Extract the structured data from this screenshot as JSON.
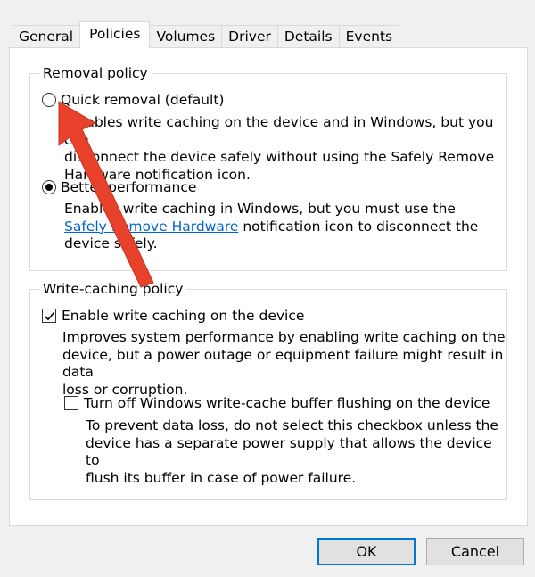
{
  "tabs": [
    {
      "label": "General"
    },
    {
      "label": "Policies"
    },
    {
      "label": "Volumes"
    },
    {
      "label": "Driver"
    },
    {
      "label": "Details"
    },
    {
      "label": "Events"
    }
  ],
  "removal": {
    "title": "Removal policy",
    "quick_label": "Quick removal (default)",
    "quick_desc_1": "Disables write caching on the device and in Windows, but you can",
    "quick_desc_2": "disconnect the device safely without using the Safely Remove",
    "quick_desc_3": "Hardware notification icon.",
    "better_label": "Better performance",
    "better_desc_1": "Enables write caching in Windows, but you must use the",
    "better_link": "Safely Remove Hardware",
    "better_desc_2": " notification icon to disconnect the",
    "better_desc_3": "device safely."
  },
  "writecache": {
    "title": "Write-caching policy",
    "enable_label": "Enable write caching on the device",
    "enable_desc_1": "Improves system performance by enabling write caching on the",
    "enable_desc_2": "device, but a power outage or equipment failure might result in data",
    "enable_desc_3": "loss or corruption.",
    "turnoff_label": "Turn off Windows write-cache buffer flushing on the device",
    "turnoff_desc_1": "To prevent data loss, do not select this checkbox unless the",
    "turnoff_desc_2": "device has a separate power supply that allows the device to",
    "turnoff_desc_3": "flush its buffer in case of power failure."
  },
  "buttons": {
    "ok": "OK",
    "cancel": "Cancel"
  },
  "annotation": {
    "arrow_color": "#e8412c"
  }
}
